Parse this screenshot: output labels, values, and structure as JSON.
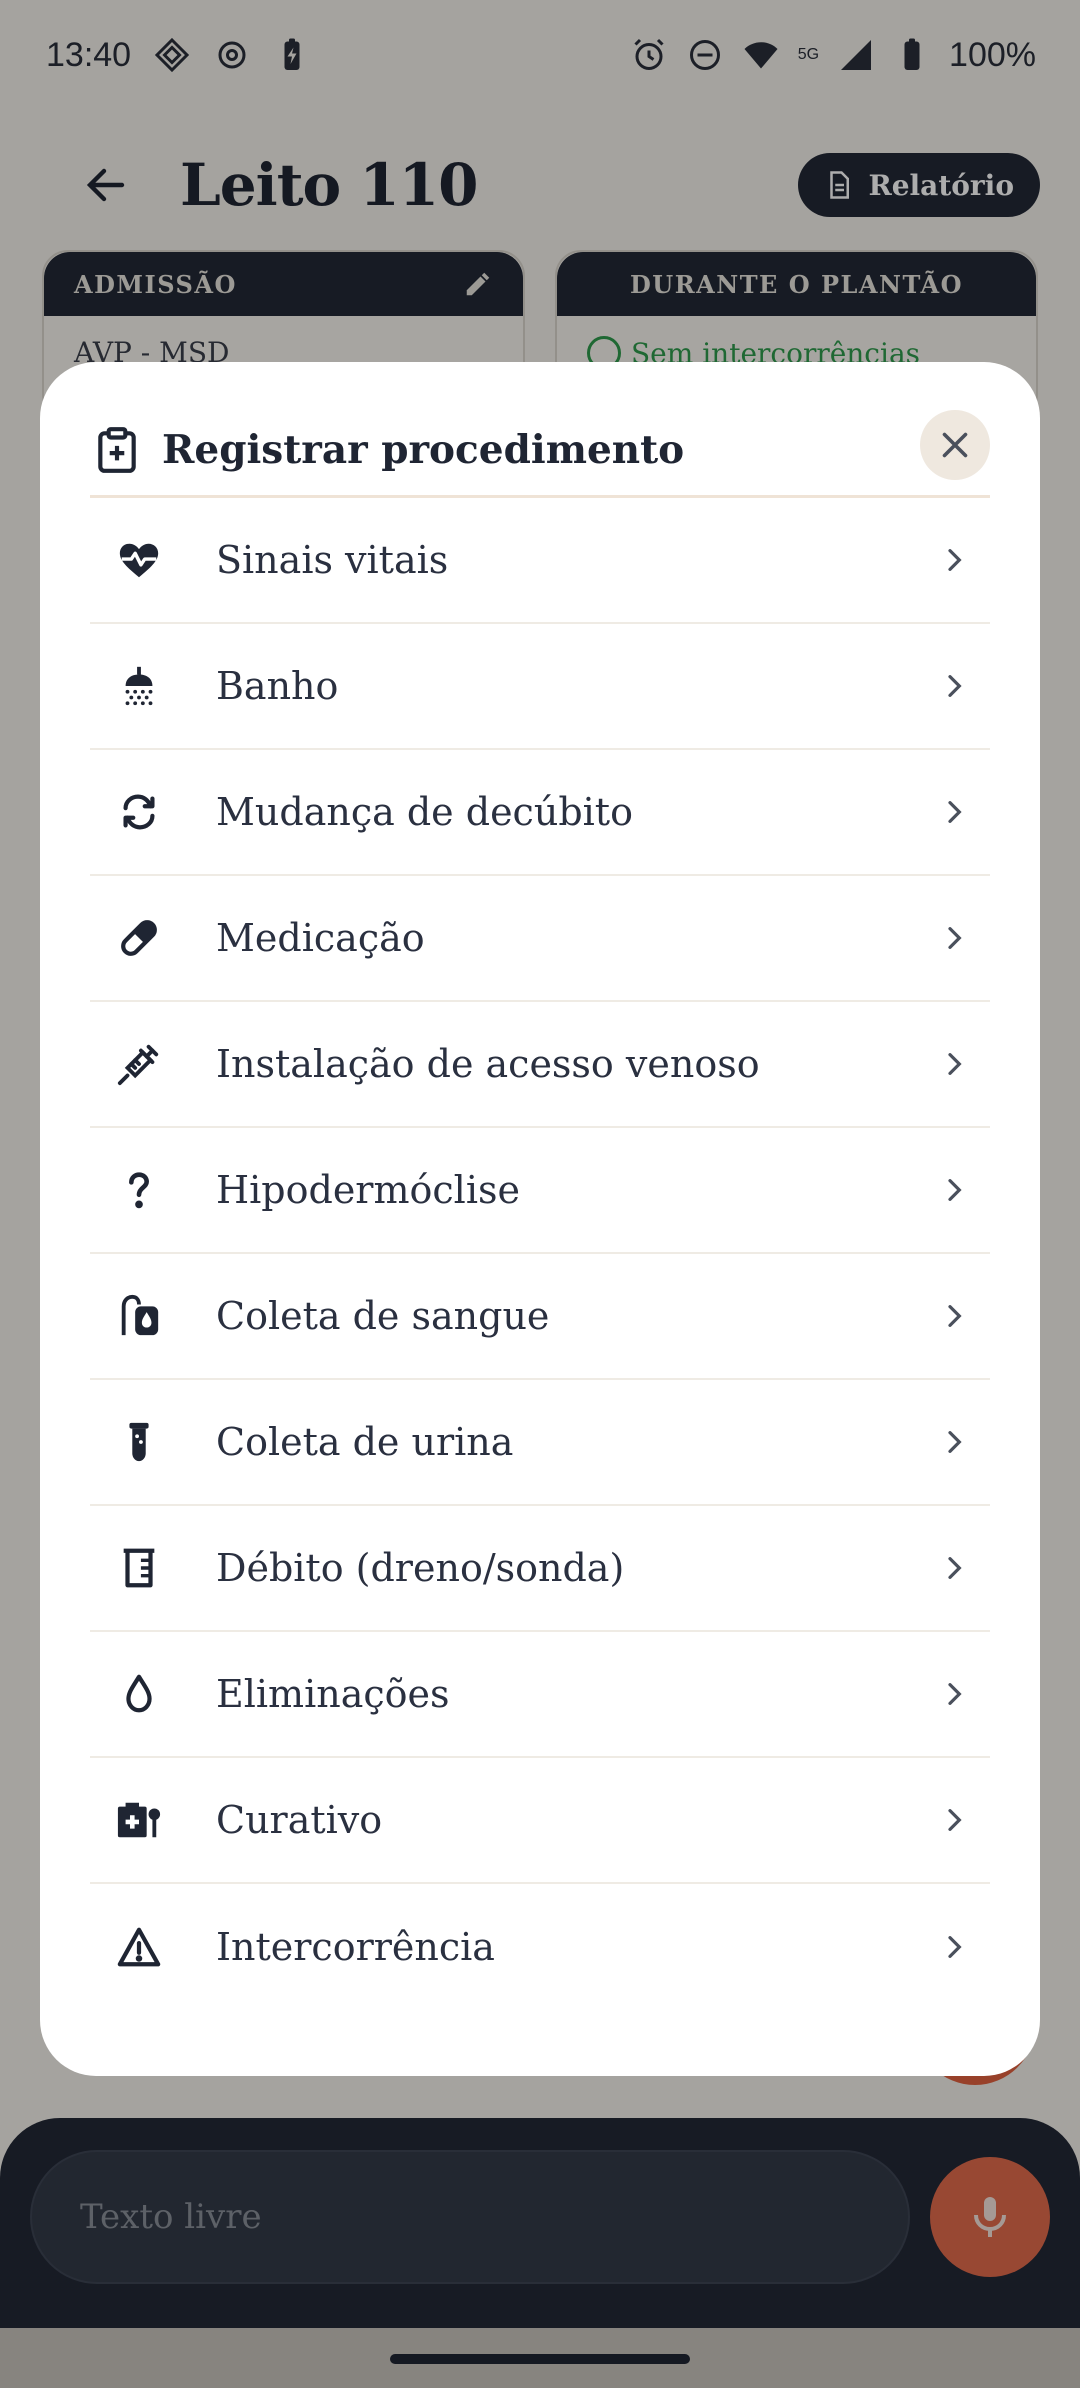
{
  "status_bar": {
    "time": "13:40",
    "battery": "100%",
    "network": "5G"
  },
  "app_bar": {
    "title": "Leito 110",
    "report_button": "Relatório"
  },
  "cards": {
    "admission": {
      "header": "ADMISSÃO",
      "preview": "AVP - MSD"
    },
    "shift": {
      "header": "DURANTE O PLANTÃO",
      "preview": "Sem intercorrências"
    }
  },
  "modal": {
    "title": "Registrar procedimento",
    "items": [
      {
        "label": "Sinais vitais",
        "icon": "heart-pulse-icon"
      },
      {
        "label": "Banho",
        "icon": "shower-icon"
      },
      {
        "label": "Mudança de decúbito",
        "icon": "rotate-icon"
      },
      {
        "label": "Medicação",
        "icon": "pill-icon"
      },
      {
        "label": "Instalação de acesso venoso",
        "icon": "syringe-icon"
      },
      {
        "label": "Hipodermóclise",
        "icon": "question-icon"
      },
      {
        "label": "Coleta de sangue",
        "icon": "blood-bag-icon"
      },
      {
        "label": "Coleta de urina",
        "icon": "test-tube-icon"
      },
      {
        "label": "Débito (dreno/sonda)",
        "icon": "beaker-icon"
      },
      {
        "label": "Eliminações",
        "icon": "drop-icon"
      },
      {
        "label": "Curativo",
        "icon": "first-aid-kit-icon"
      },
      {
        "label": "Intercorrência",
        "icon": "warning-triangle-icon"
      }
    ]
  },
  "input": {
    "placeholder": "Texto livre"
  },
  "colors": {
    "dark": "#222836",
    "accent": "#e06a4c",
    "surface": "#ffffff",
    "background": "#f3f0ea"
  }
}
